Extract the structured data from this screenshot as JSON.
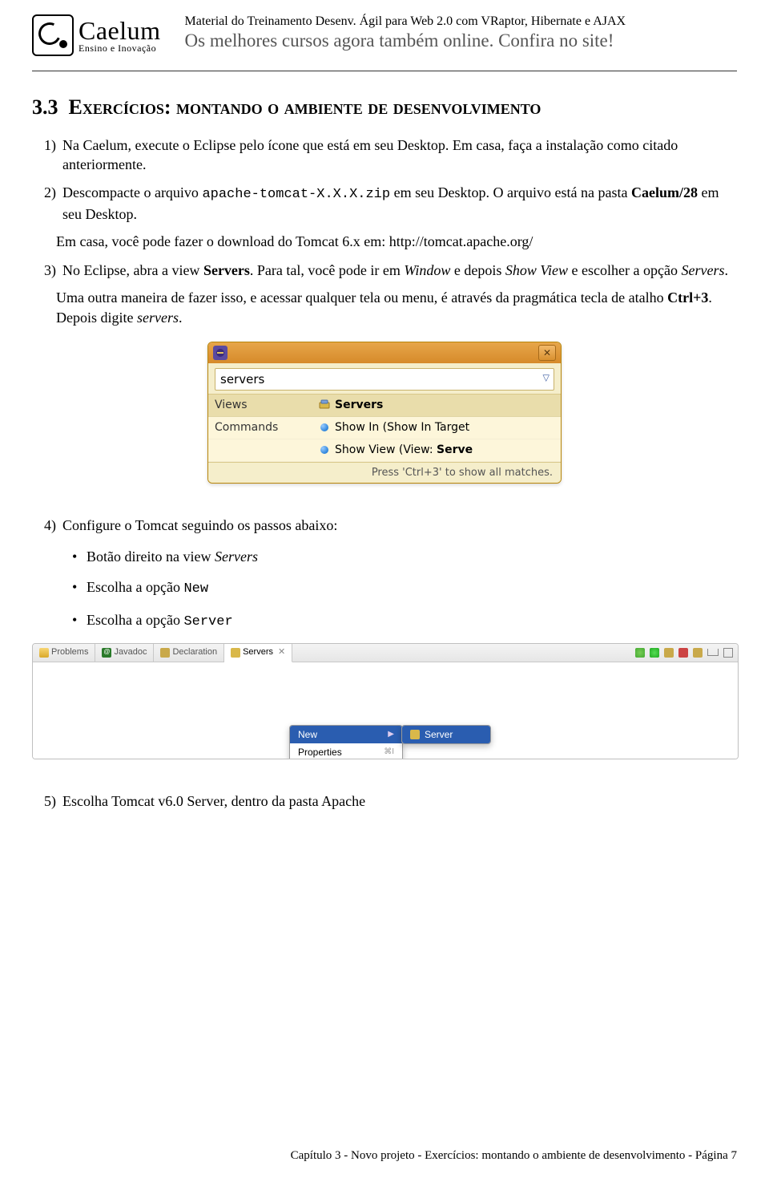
{
  "header": {
    "logo_name": "Caelum",
    "logo_tagline": "Ensino e Inovação",
    "training_line": "Material do Treinamento Desenv. Ágil para Web 2.0 com VRaptor, Hibernate e AJAX",
    "subhead": "Os melhores cursos agora também online. Confira no site!"
  },
  "section": {
    "number": "3.3",
    "title": "Exercícios: montando o ambiente de desenvolvimento"
  },
  "items": {
    "n1": "1)",
    "t1": "Na Caelum, execute o Eclipse pelo ícone que está em seu Desktop. Em casa, faça a instalação como citado anteriormente.",
    "n2": "2)",
    "t2a": "Descompacte o arquivo ",
    "t2_code": "apache-tomcat-X.X.X.zip",
    "t2b": " em seu Desktop. O arquivo está na pasta ",
    "t2_bold": "Caelum/28",
    "t2c": " em seu Desktop.",
    "t2_p2": "Em casa, você pode fazer o download do Tomcat 6.x em: http://tomcat.apache.org/",
    "n3": "3)",
    "t3a": "No Eclipse, abra a view ",
    "t3_bold1": "Servers",
    "t3b": ". Para tal, você pode ir em ",
    "t3_i1": "Window",
    "t3c": " e depois ",
    "t3_i2": "Show View",
    "t3d": " e escolher a opção ",
    "t3_i3": "Servers",
    "t3e": ".",
    "t3_p2a": "Uma outra maneira de fazer isso, e acessar qualquer tela ou menu, é através da pragmática tecla de atalho ",
    "t3_p2_bold": "Ctrl+3",
    "t3_p2b": ". Depois digite ",
    "t3_p2_i": "servers",
    "t3_p2c": ".",
    "n4": "4)",
    "t4": "Configure o Tomcat seguindo os passos abaixo:",
    "b1a": "Botão direito na view ",
    "b1i": "Servers",
    "b2a": "Escolha a opção ",
    "b2m": "New",
    "b3a": "Escolha a opção ",
    "b3m": "Server",
    "n5": "5)",
    "t5": "Escolha Tomcat v6.0 Server, dentro da pasta Apache"
  },
  "dialog": {
    "input_value": "servers",
    "cat_views": "Views",
    "cat_commands": "Commands",
    "r1": "Servers",
    "r2": "Show In (Show In Target",
    "r3a": "Show View (View: ",
    "r3b": "Serve",
    "footer": "Press 'Ctrl+3' to show all matches."
  },
  "panel": {
    "tab_problems": "Problems",
    "tab_javadoc": "Javadoc",
    "tab_decl": "Declaration",
    "tab_servers": "Servers",
    "ctx_new": "New",
    "ctx_props": "Properties",
    "ctx_props_hint": "⌘I",
    "sub_server": "Server"
  },
  "footer": "Capítulo 3 - Novo projeto - Exercícios: montando o ambiente de desenvolvimento - Página 7"
}
